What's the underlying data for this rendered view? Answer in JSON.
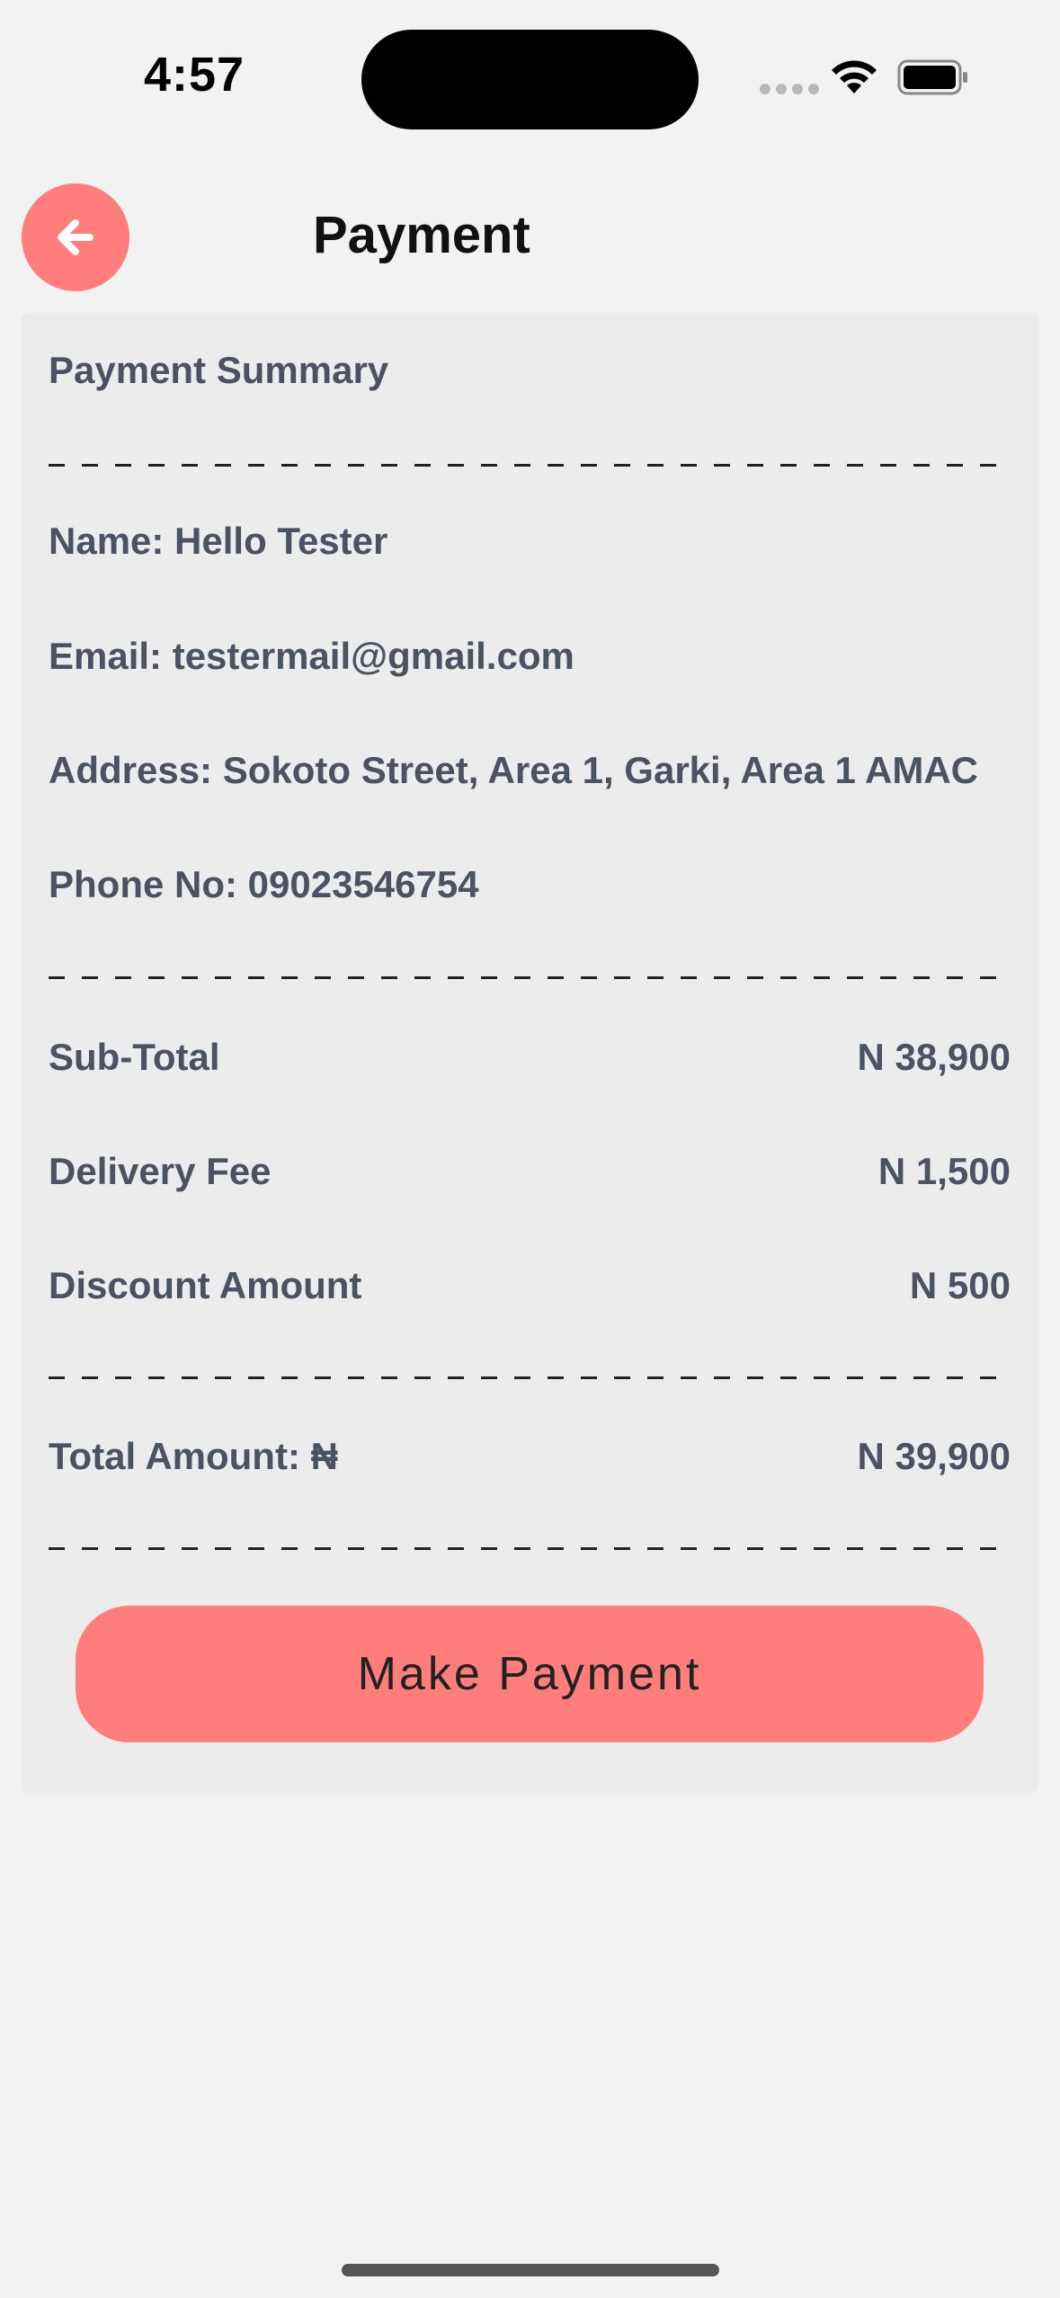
{
  "status_bar": {
    "time": "4:57"
  },
  "header": {
    "title": "Payment",
    "back_icon": "arrow-left-icon"
  },
  "summary": {
    "heading": "Payment Summary",
    "name": "Name: Hello Tester",
    "email": "Email: testermail@gmail.com",
    "address": "Address: Sokoto Street, Area 1, Garki, Area 1 AMAC",
    "phone": "Phone No: 09023546754"
  },
  "amounts": {
    "subtotal_label": "Sub-Total",
    "subtotal_value": "N 38,900",
    "delivery_label": "Delivery Fee",
    "delivery_value": "N 1,500",
    "discount_label": "Discount Amount",
    "discount_value": "N 500",
    "total_label": "Total Amount: ₦",
    "total_value": "N 39,900"
  },
  "action": {
    "pay_label": "Make Payment"
  },
  "colors": {
    "accent": "#ff7e7b",
    "text": "#4b5262",
    "background": "#f2f2f2",
    "card": "#ececec"
  }
}
